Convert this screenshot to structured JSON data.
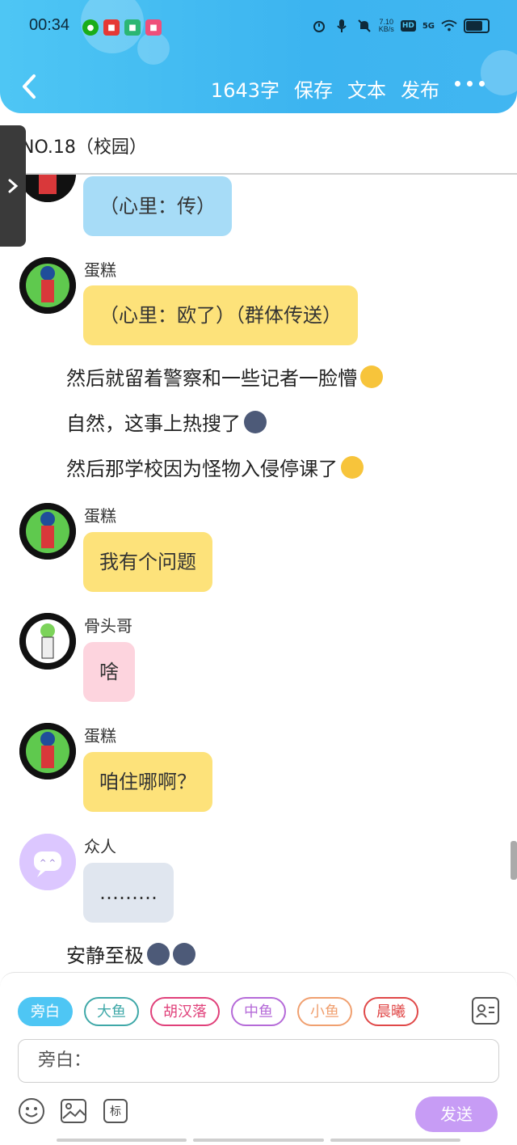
{
  "status": {
    "time": "00:34",
    "net_speed_value": "7.10",
    "net_speed_unit": "KB/s",
    "hd": "HD",
    "network": "5G"
  },
  "header": {
    "word_count": "1643字",
    "save": "保存",
    "text": "文本",
    "publish": "发布"
  },
  "title": "NO.18（校园）",
  "messages": [
    {
      "type": "bubble",
      "text": "（心里：传）",
      "color": "blue"
    },
    {
      "type": "bubble",
      "sender": "蛋糕",
      "text": "（心里：欧了）（群体传送）",
      "color": "yellow"
    },
    {
      "type": "narration",
      "text": "然后就留着警察和一些记者一脸懵",
      "emoji": "upside-down-face"
    },
    {
      "type": "narration",
      "text": "自然，这事上热搜了",
      "emoji": "new-moon-face"
    },
    {
      "type": "narration",
      "text": "然后那学校因为怪物入侵停课了",
      "emoji": "upside-down-face"
    },
    {
      "type": "bubble",
      "sender": "蛋糕",
      "text": "我有个问题",
      "color": "yellow"
    },
    {
      "type": "bubble",
      "sender": "骨头哥",
      "text": "啥",
      "color": "pink"
    },
    {
      "type": "bubble",
      "sender": "蛋糕",
      "text": "咱住哪啊？",
      "color": "yellow"
    },
    {
      "type": "bubble",
      "sender": "众人",
      "text": "………",
      "color": "grey"
    },
    {
      "type": "narration",
      "text": "安静至极",
      "emoji": "new-moon-face x2"
    }
  ],
  "composer": {
    "roles": [
      {
        "label": "旁白",
        "color": "#4ec6f4",
        "active": true
      },
      {
        "label": "大鱼",
        "color": "#3fa8a8"
      },
      {
        "label": "胡汉落",
        "color": "#e0407a"
      },
      {
        "label": "中鱼",
        "color": "#b56ad8"
      },
      {
        "label": "小鱼",
        "color": "#f0a070"
      },
      {
        "label": "晨曦",
        "color": "#e04848"
      }
    ],
    "input_value": "旁白：",
    "tag_label": "标",
    "send": "发送"
  },
  "colors": {
    "header": "#3cb4f0",
    "bubble_blue": "#a7dcf7",
    "bubble_yellow": "#fde27a",
    "bubble_pink": "#fdd4de",
    "bubble_grey": "#e0e6ef",
    "send_button": "#c79cf5"
  },
  "icons": [
    "back-arrow-icon",
    "more-dots-icon",
    "expand-chevron-icon",
    "emoji-icon",
    "image-icon",
    "role-card-icon"
  ]
}
